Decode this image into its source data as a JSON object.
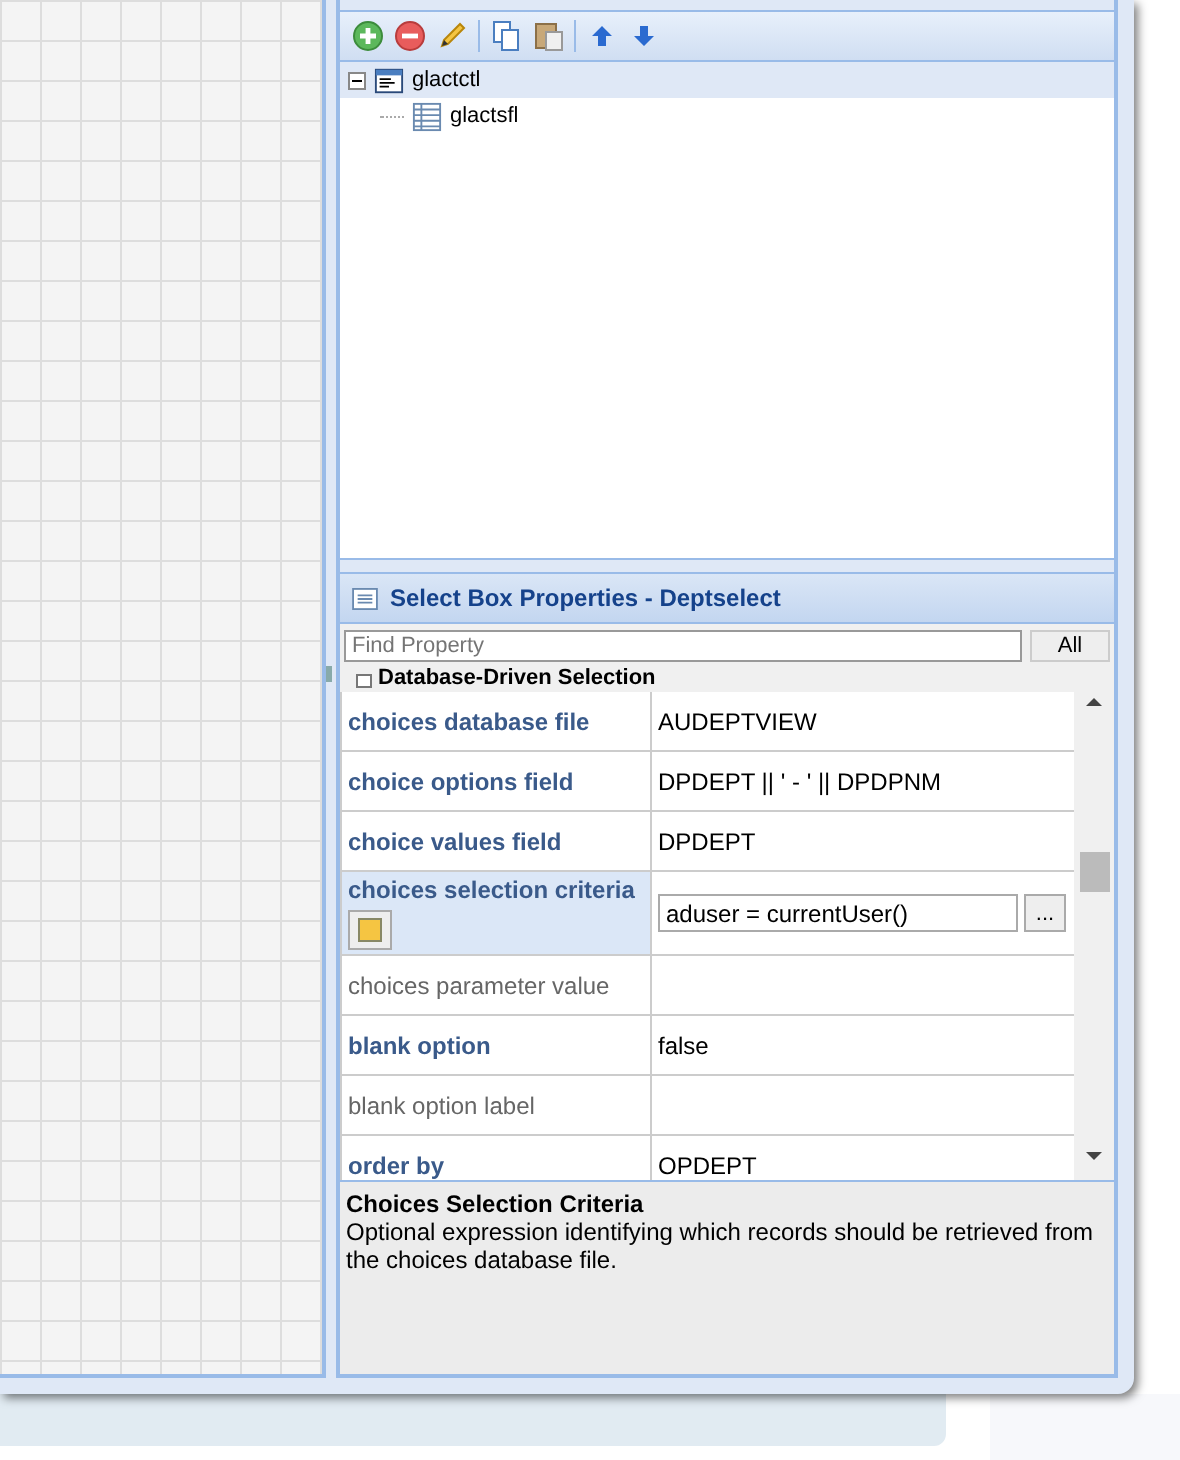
{
  "tree": [
    {
      "label": "glactctl",
      "kind": "container",
      "expanded": true,
      "selected": true,
      "children": [
        {
          "label": "glactsfl",
          "kind": "grid",
          "selected": false
        }
      ]
    }
  ],
  "properties": {
    "title": "Select Box Properties - Deptselect",
    "search": {
      "placeholder": "Find Property"
    },
    "filter_button": "All",
    "section": "Database-Driven Selection",
    "rows": [
      {
        "label": "choices database file",
        "value": "AUDEPTVIEW",
        "set": true,
        "selected": false,
        "editing": false
      },
      {
        "label": "choice options field",
        "value": "DPDEPT || ' -  ' || DPDPNM",
        "set": true,
        "selected": false,
        "editing": false
      },
      {
        "label": "choice values field",
        "value": "DPDEPT",
        "set": true,
        "selected": false,
        "editing": false
      },
      {
        "label": "choices selection criteria",
        "value": "aduser = currentUser()",
        "set": true,
        "selected": true,
        "editing": true,
        "browse": "..."
      },
      {
        "label": "choices parameter value",
        "value": "",
        "set": false,
        "selected": false,
        "editing": false
      },
      {
        "label": "blank option",
        "value": "false",
        "set": true,
        "selected": false,
        "editing": false
      },
      {
        "label": "blank option label",
        "value": "",
        "set": false,
        "selected": false,
        "editing": false
      },
      {
        "label": "order by",
        "value": "OPDEPT",
        "set": true,
        "selected": false,
        "editing": false
      }
    ],
    "description": {
      "title": "Choices Selection Criteria",
      "text": "Optional expression identifying which records should be retrieved from the choices database file."
    }
  }
}
